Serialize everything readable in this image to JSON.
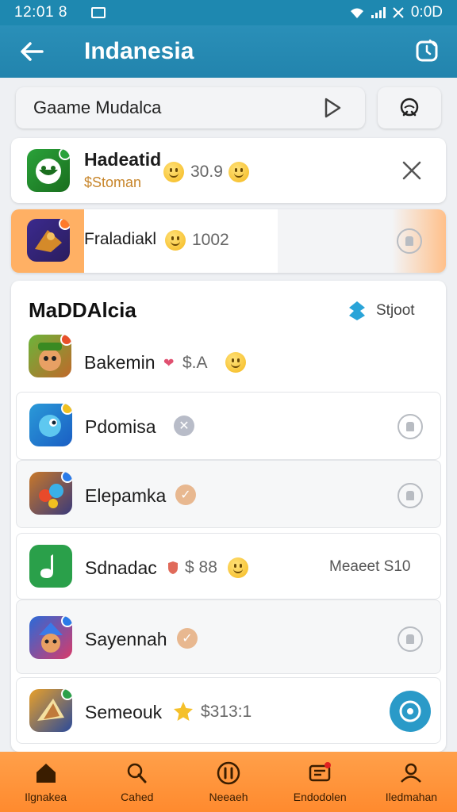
{
  "status_bar": {
    "time": "12:01 8",
    "right_text": "0:0D"
  },
  "app_bar": {
    "title": "Indanesia"
  },
  "search": {
    "value": "Gaame Mudalca"
  },
  "top_list": [
    {
      "name": "Hadeatid",
      "tag": "$Stoman",
      "price": "30.9"
    },
    {
      "name": "Fraladiakl",
      "price": "1002"
    }
  ],
  "section": {
    "title": "MaDDAlcia",
    "action_label": "Stjoot",
    "items": [
      {
        "name": "Bakemin",
        "price": "$.A"
      },
      {
        "name": "Pdomisa"
      },
      {
        "name": "Elepamka"
      },
      {
        "name": "Sdnadac",
        "price": "$ 88",
        "extra": "Meaeet S10"
      },
      {
        "name": "Sayennah"
      },
      {
        "name": "Semeouk",
        "price": "$313:1"
      }
    ]
  },
  "tabs": [
    {
      "label": "Ilgnakea"
    },
    {
      "label": "Cahed"
    },
    {
      "label": "Neeaeh"
    },
    {
      "label": "Endodolen"
    },
    {
      "label": "Iledmahan"
    }
  ],
  "colors": {
    "app_bar": "#2284ad",
    "tab_bar": "#ff8a2e",
    "highlight": "#ffb679"
  }
}
